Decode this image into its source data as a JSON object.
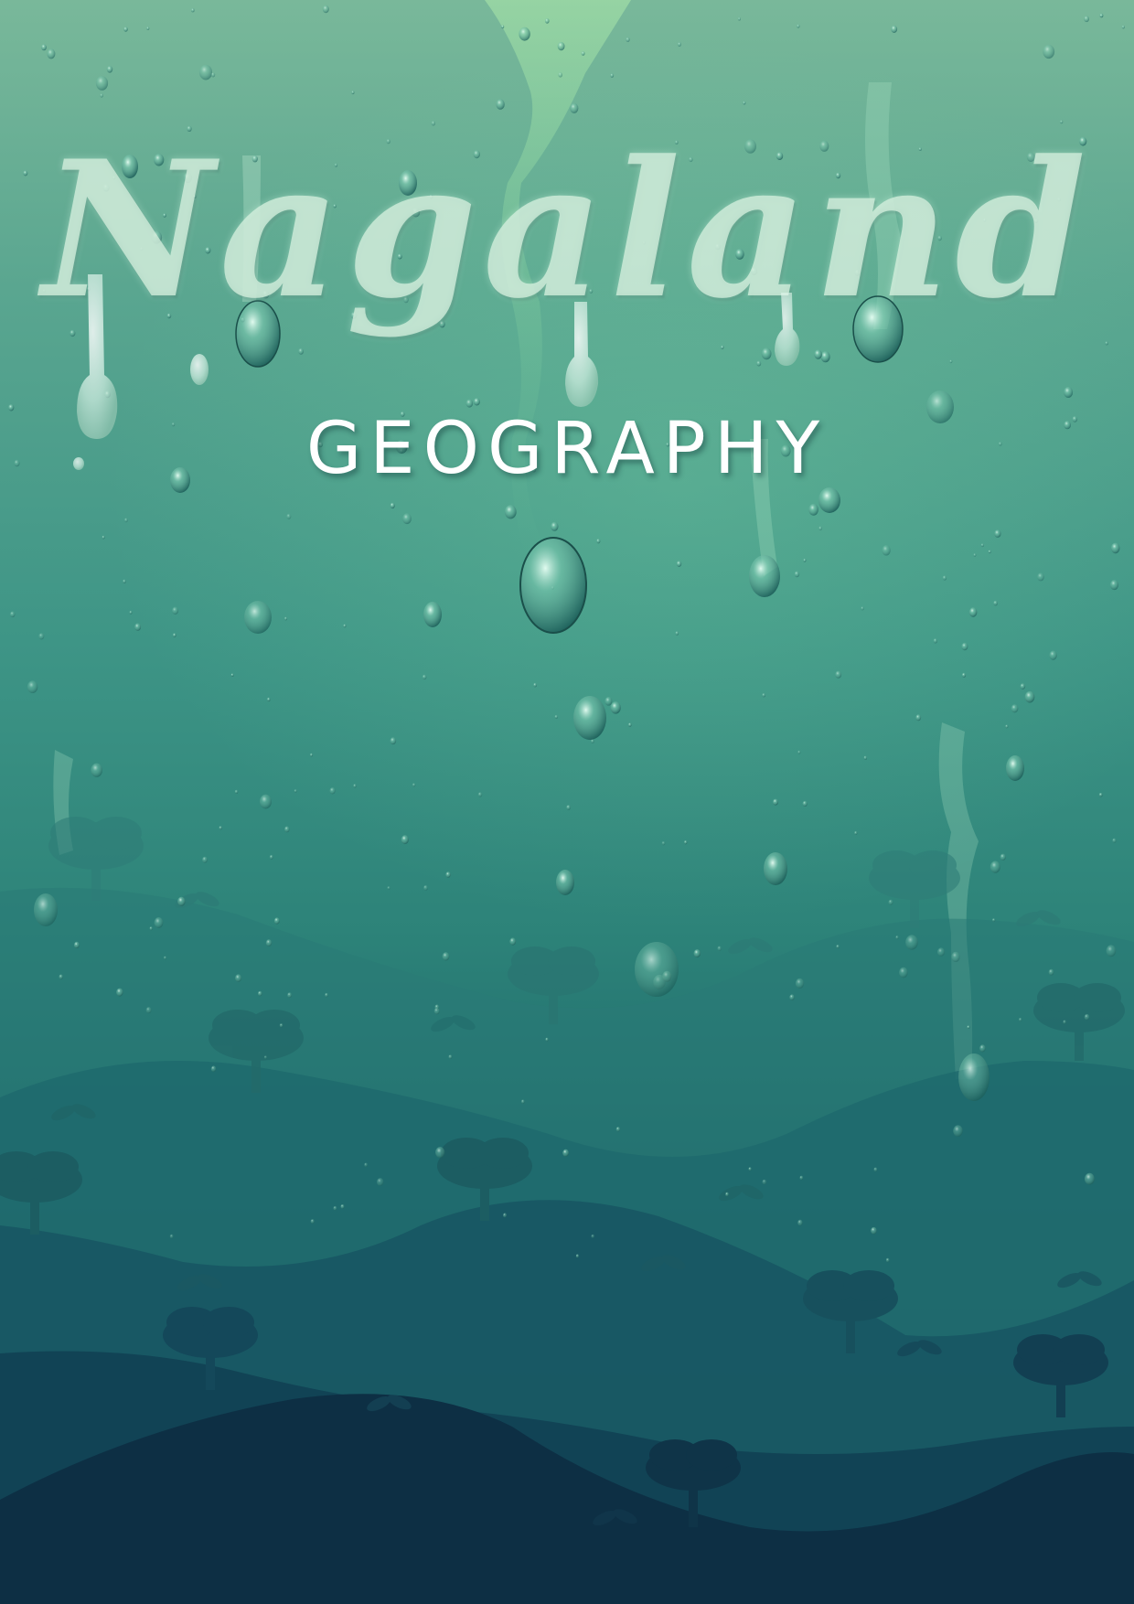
{
  "cover": {
    "title": "Nagaland",
    "subtitle": "GEOGRAPHY"
  },
  "colors": {
    "sky_top": "#79b89a",
    "sky_mid": "#3e9586",
    "ground_dark": "#0e2a3d",
    "title_text": "#d4eedd",
    "subtitle_text": "#ffffff"
  },
  "illustration": {
    "elements": [
      "water-droplets",
      "drip-streaks",
      "rolling-hills",
      "tree-silhouettes",
      "leaf-sprouts"
    ]
  }
}
